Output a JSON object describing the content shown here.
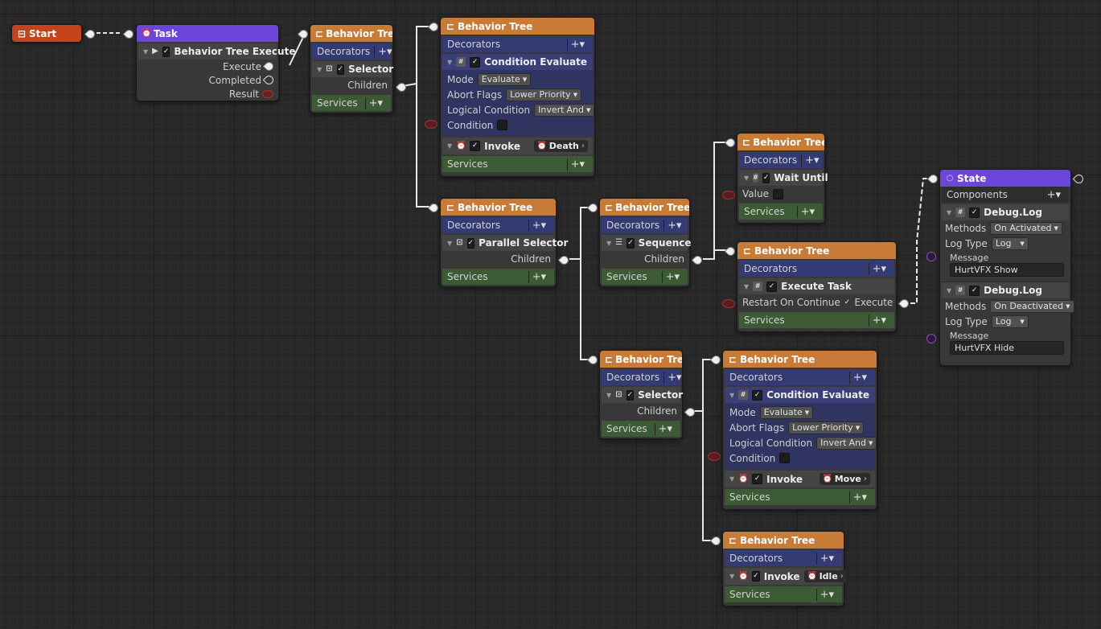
{
  "start": {
    "title": "Start"
  },
  "task": {
    "title": "Task",
    "item": "Behavior Tree Execute",
    "ports": [
      "Execute",
      "Completed",
      "Result"
    ]
  },
  "common": {
    "bt_title": "Behavior Tree",
    "decorators": "Decorators",
    "services": "Services",
    "children": "Children",
    "plus": "+▾",
    "state_title": "State",
    "components": "Components"
  },
  "selector": {
    "label": "Selector"
  },
  "parallel": {
    "label": "Parallel Selector"
  },
  "sequence": {
    "label": "Sequence"
  },
  "condition": {
    "label": "Condition Evaluate",
    "mode_label": "Mode",
    "mode_value": "Evaluate",
    "abort_label": "Abort Flags",
    "abort_value": "Lower Priority",
    "logic_label": "Logical Condition",
    "logic_invert": "Invert",
    "logic_value": "And",
    "cond_label": "Condition"
  },
  "invoke": {
    "label": "Invoke",
    "death": "Death",
    "move": "Move",
    "idle": "Idle"
  },
  "wait": {
    "label": "Wait Until",
    "value_label": "Value"
  },
  "exec_task": {
    "label": "Execute Task",
    "restart": "Restart On Continue",
    "execute": "Execute"
  },
  "state": {
    "comp1": {
      "label": "Debug.Log",
      "methods_label": "Methods",
      "methods_value": "On Activated",
      "logtype_label": "Log Type",
      "logtype_value": "Log",
      "message_label": "Message",
      "message_value": "HurtVFX Show"
    },
    "comp2": {
      "label": "Debug.Log",
      "methods_label": "Methods",
      "methods_value": "On Deactivated",
      "logtype_label": "Log Type",
      "logtype_value": "Log",
      "message_label": "Message",
      "message_value": "HurtVFX Hide"
    }
  },
  "colors": {
    "orange": "#c77b37",
    "purple": "#6c46d9",
    "red": "#c5431c",
    "blue": "#343a73",
    "green": "#3c5a34"
  }
}
